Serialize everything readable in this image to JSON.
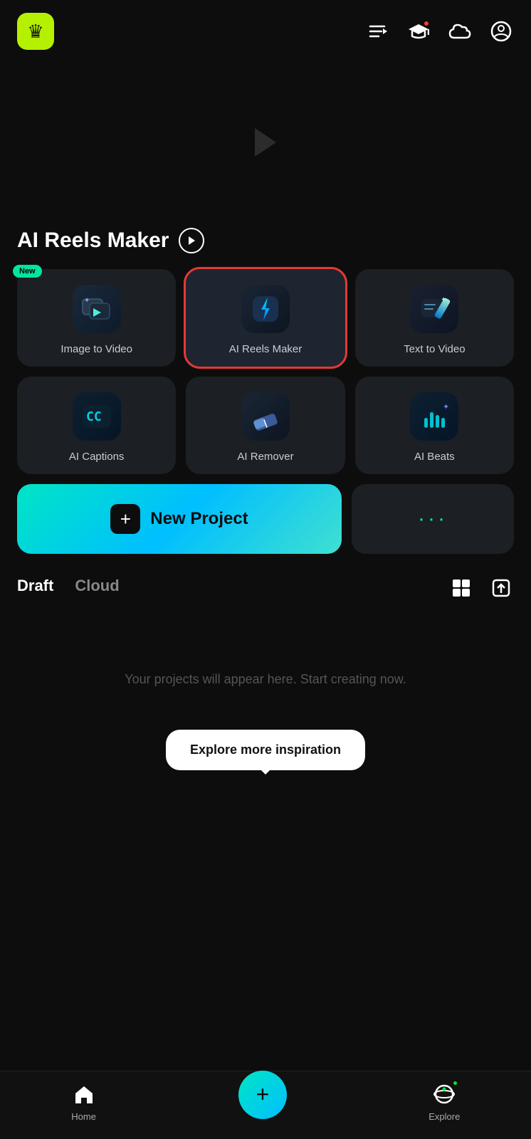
{
  "header": {
    "logo_alt": "App Logo",
    "icons": [
      "list-icon",
      "graduation-cap-icon",
      "cloud-icon",
      "face-icon"
    ]
  },
  "section": {
    "title": "AI Reels Maker",
    "arrow_label": "navigate"
  },
  "tools": {
    "row1": [
      {
        "id": "image-to-video",
        "label": "Image to Video",
        "badge": "New",
        "highlighted": false
      },
      {
        "id": "ai-reels-maker",
        "label": "AI Reels Maker",
        "badge": null,
        "highlighted": true
      },
      {
        "id": "text-to-video",
        "label": "Text to Video",
        "badge": null,
        "highlighted": false
      }
    ],
    "row2": [
      {
        "id": "ai-captions",
        "label": "AI Captions",
        "badge": null,
        "highlighted": false
      },
      {
        "id": "ai-remover",
        "label": "AI Remover",
        "badge": null,
        "highlighted": false
      },
      {
        "id": "ai-beats",
        "label": "AI Beats",
        "badge": null,
        "highlighted": false
      }
    ]
  },
  "new_project": {
    "label": "New Project",
    "more_dots": "···"
  },
  "tabs": {
    "draft": "Draft",
    "cloud": "Cloud",
    "active": "Draft"
  },
  "empty_state": {
    "message": "Your projects will appear here. Start creating now."
  },
  "tooltip": {
    "text": "Explore more inspiration"
  },
  "bottom_nav": {
    "home_label": "Home",
    "explore_label": "Explore"
  }
}
